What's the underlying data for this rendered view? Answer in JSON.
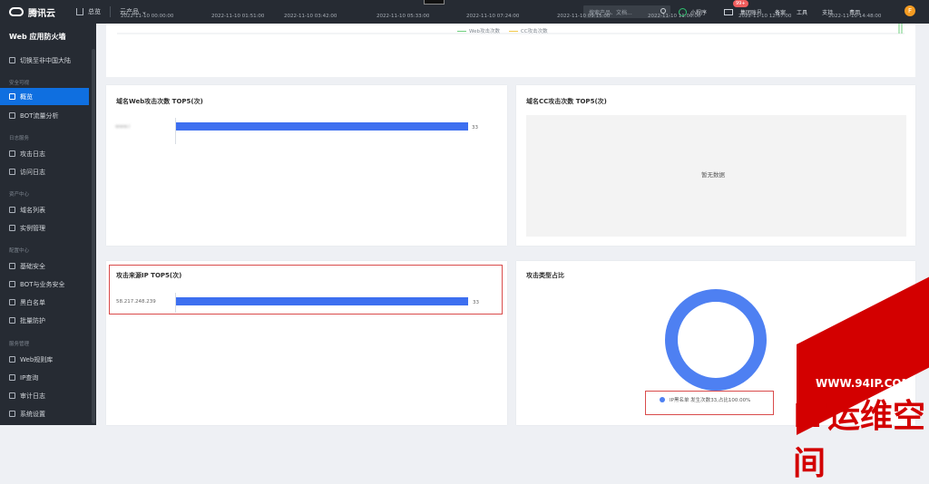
{
  "topbar": {
    "brand": "腾讯云",
    "home": "总览",
    "products": "云产品",
    "search_placeholder": "搜索产品、文档...",
    "mini_program": "小程序",
    "badge": "99+",
    "group_account": "集团账号",
    "beian": "备案",
    "tools": "工具",
    "support": "支持",
    "cost": "费用",
    "avatar_letter": "F"
  },
  "sidebar": {
    "title": "Web 应用防火墙",
    "switch_region": "切换至非中国大陆",
    "groups": [
      {
        "label": "安全可视",
        "items": [
          "概览",
          "BOT流量分析"
        ]
      },
      {
        "label": "日志服务",
        "items": [
          "攻击日志",
          "访问日志"
        ]
      },
      {
        "label": "资产中心",
        "items": [
          "域名列表",
          "实例管理"
        ]
      },
      {
        "label": "配置中心",
        "items": [
          "基础安全",
          "BOT与业务安全",
          "黑白名单",
          "批量防护"
        ]
      },
      {
        "label": "服务管理",
        "items": [
          "Web规则库",
          "IP查询",
          "审计日志",
          "系统设置"
        ]
      }
    ]
  },
  "timeline": {
    "labels": [
      "2022-11-10 00:00:00",
      "2022-11-10 01:51:00",
      "2022-11-10 03:42:00",
      "2022-11-10 05:33:00",
      "2022-11-10 07:24:00",
      "2022-11-10 09:15:00",
      "2022-11-10 11:06:00",
      "2022-11-10 12:57:00",
      "2022-11-10 14:48:00"
    ],
    "legend_web": "Web攻击次数",
    "legend_cc": "CC攻击次数"
  },
  "panels": {
    "web_top5_title": "域名Web攻击次数 TOP5(次)",
    "web_top5_domain": "www.i",
    "web_top5_value": "33",
    "cc_top5_title": "域名CC攻击次数 TOP5(次)",
    "no_data": "暂无数据",
    "ip_top5_title": "攻击来源IP TOP5(次)",
    "ip_top5_ip": "58.217.248.239",
    "ip_top5_value": "33",
    "attack_type_title": "攻击类型占比",
    "attack_type_legend": "IP黑名单 发生次数33,占比100.00%"
  },
  "watermark": {
    "domain": "WWW.94IP.COM",
    "name": "IT运维空间"
  },
  "colors": {
    "accent": "#0f6fe0",
    "bar": "#3d6ff0",
    "donut": "#4e80f2",
    "highlight_box": "#d94b4b"
  },
  "chart_data": [
    {
      "type": "bar",
      "title": "域名Web攻击次数 TOP5(次)",
      "categories": [
        "www.i"
      ],
      "values": [
        33
      ]
    },
    {
      "type": "bar",
      "title": "攻击来源IP TOP5(次)",
      "categories": [
        "58.217.248.239"
      ],
      "values": [
        33
      ]
    },
    {
      "type": "pie",
      "title": "攻击类型占比",
      "categories": [
        "IP黑名单"
      ],
      "values": [
        100
      ]
    }
  ]
}
